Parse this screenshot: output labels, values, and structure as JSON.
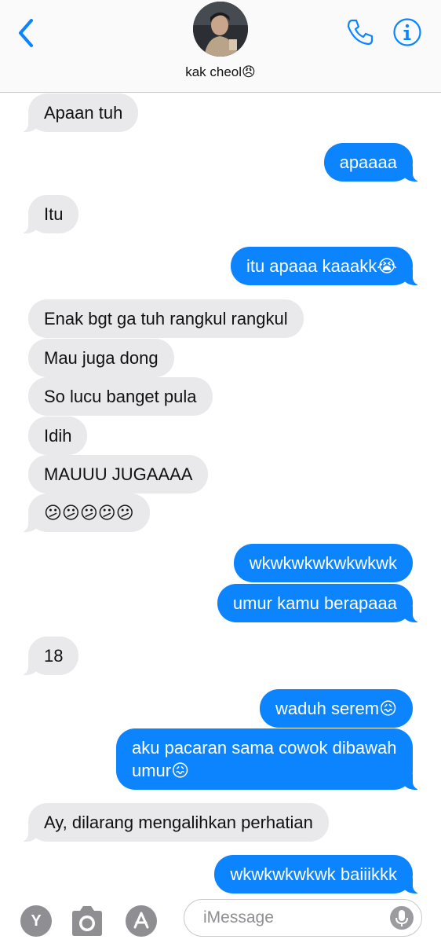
{
  "header": {
    "contact_name": "kak cheol😠"
  },
  "messages": [
    {
      "dir": "in",
      "text": "Apaan tuh"
    },
    {
      "dir": "out",
      "text": "apaaaa"
    },
    {
      "dir": "in",
      "text": "Itu"
    },
    {
      "dir": "out",
      "text": "itu apaaa kaaakk😭"
    },
    {
      "dir": "in",
      "text": "Enak bgt ga tuh rangkul rangkul"
    },
    {
      "dir": "in",
      "text": "Mau juga dong"
    },
    {
      "dir": "in",
      "text": "So lucu banget pula"
    },
    {
      "dir": "in",
      "text": "Idih"
    },
    {
      "dir": "in",
      "text": "MAUUU JUGAAAA"
    },
    {
      "dir": "in",
      "text": "😕😕😕😕😕"
    },
    {
      "dir": "out",
      "text": "wkwkwkwkwkwkwk"
    },
    {
      "dir": "out",
      "text": "umur kamu berapaaa"
    },
    {
      "dir": "in",
      "text": "18"
    },
    {
      "dir": "out",
      "text": "waduh serem😖"
    },
    {
      "dir": "out",
      "text": "aku pacaran sama cowok dibawah umur😖"
    },
    {
      "dir": "in",
      "text": "Ay, dilarang mengalihkan perhatian"
    },
    {
      "dir": "out",
      "text": "wkwkwkwkwk baiiikkk"
    }
  ],
  "composer": {
    "placeholder": "iMessage",
    "app_button_label": "Y"
  },
  "colors": {
    "outgoing_bubble": "#0b84fe",
    "incoming_bubble": "#e9e9eb",
    "accent": "#0b84fe"
  },
  "icons": [
    "back-chevron-icon",
    "phone-icon",
    "info-icon",
    "camera-icon",
    "app-store-icon",
    "microphone-icon"
  ]
}
